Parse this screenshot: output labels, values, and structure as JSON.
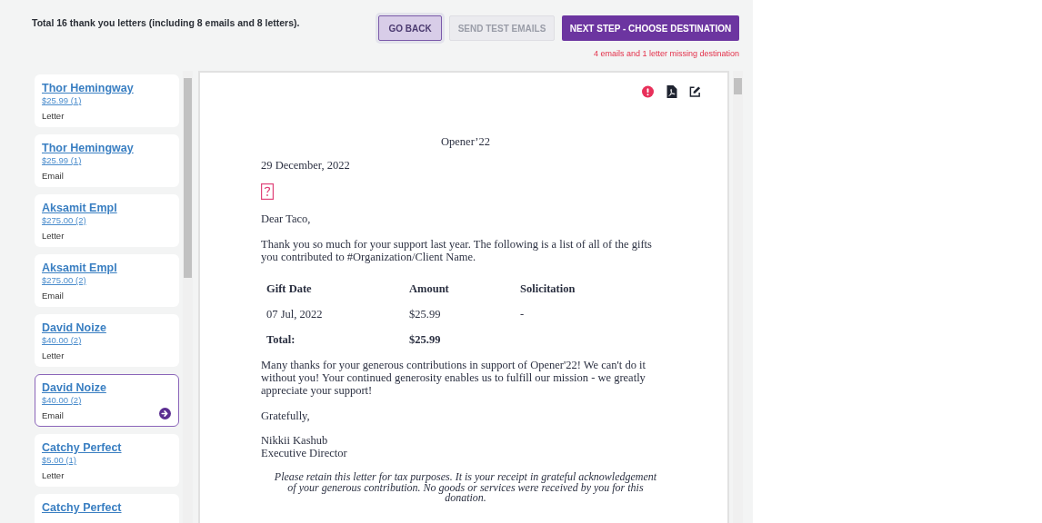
{
  "summary": "Total 16 thank you letters (including 8 emails and 8 letters).",
  "buttons": [
    {
      "label": "GO BACK",
      "kind": "secondary"
    },
    {
      "label": "SEND TEST EMAILS",
      "kind": "disabled"
    },
    {
      "label": "NEXT STEP - CHOOSE DESTINATION",
      "kind": "primary"
    }
  ],
  "warning": "4 emails and 1 letter missing destination",
  "recipients": [
    {
      "name": "Thor Hemingway",
      "amount": "$25.99 (1)",
      "type": "Letter",
      "selected": false
    },
    {
      "name": "Thor Hemingway",
      "amount": "$25.99 (1)",
      "type": "Email",
      "selected": false
    },
    {
      "name": "Aksamit Empl",
      "amount": "$275.00 (2)",
      "type": "Letter",
      "selected": false
    },
    {
      "name": "Aksamit Empl",
      "amount": "$275.00 (2)",
      "type": "Email",
      "selected": false
    },
    {
      "name": "David Noize",
      "amount": "$40.00 (2)",
      "type": "Letter",
      "selected": false
    },
    {
      "name": "David Noize",
      "amount": "$40.00 (2)",
      "type": "Email",
      "selected": true
    },
    {
      "name": "Catchy Perfect",
      "amount": "$5.00 (1)",
      "type": "Letter",
      "selected": false
    },
    {
      "name": "Catchy Perfect",
      "selected": false
    }
  ],
  "letter": {
    "event": "Opener’22",
    "date": "29 December, 2022",
    "salutation": "Dear Taco,",
    "intro": "Thank you so much for your support last year. The following is a list of all of the gifts you contributed to #Organization/Client Name.",
    "table": {
      "columns": [
        "Gift Date",
        "Amount",
        "Solicitation"
      ],
      "rows": [
        [
          "07 Jul, 2022",
          "$25.99",
          "-"
        ]
      ],
      "total": {
        "label": "Total:",
        "amount": "$25.99"
      }
    },
    "body": "Many thanks for your generous contributions in support of Opener'22! We can't do it without you! Your continued generosity enables us to fulfill our mission - we greatly appreciate your support!",
    "closing": "Gratefully,",
    "signer_name": "Nikkii Kashub",
    "signer_title": "Executive Director",
    "footnote": "Please retain this letter for tax purposes. It is your receipt in grateful acknowledgement of your generous contribution. No goods or services were received by you for this donation."
  }
}
